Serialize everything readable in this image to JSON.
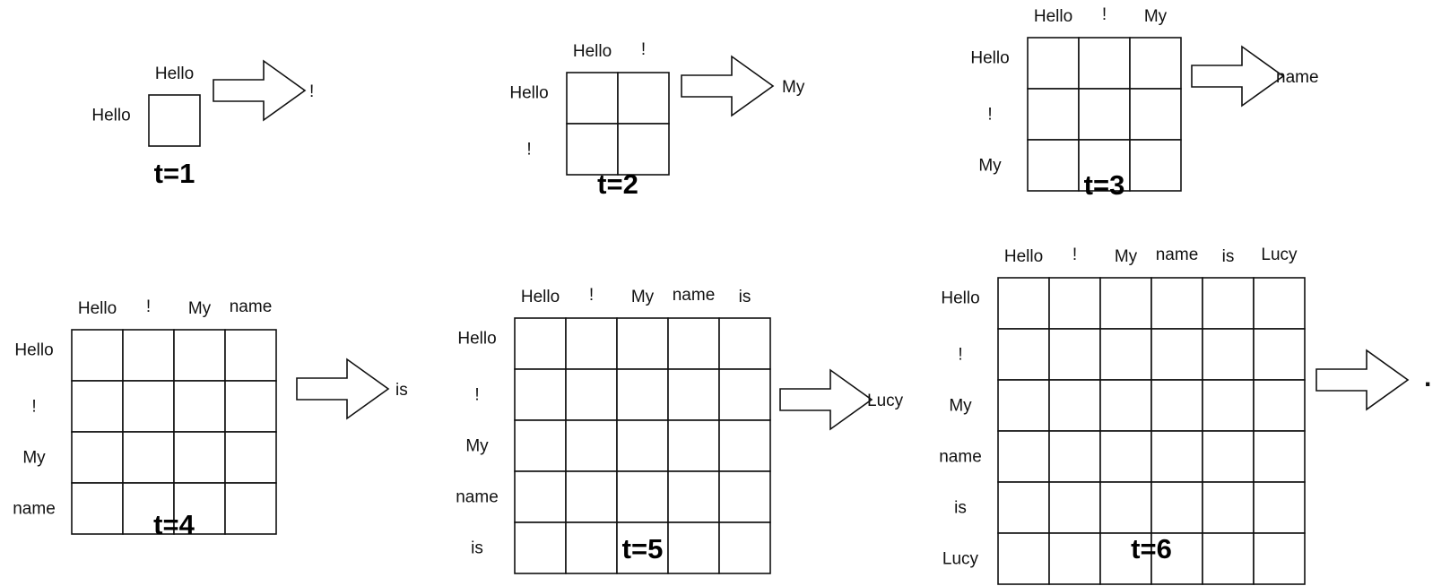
{
  "steps": [
    {
      "label": "t=1",
      "tokens": [
        "Hello"
      ],
      "output": "!"
    },
    {
      "label": "t=2",
      "tokens": [
        "Hello",
        "!"
      ],
      "output": "My"
    },
    {
      "label": "t=3",
      "tokens": [
        "Hello",
        "!",
        "My"
      ],
      "output": "name"
    },
    {
      "label": "t=4",
      "tokens": [
        "Hello",
        "!",
        "My",
        "name"
      ],
      "output": "is"
    },
    {
      "label": "t=5",
      "tokens": [
        "Hello",
        "!",
        "My",
        "name",
        "is"
      ],
      "output": "Lucy"
    },
    {
      "label": "t=6",
      "tokens": [
        "Hello",
        "!",
        "My",
        "name",
        "is",
        "Lucy"
      ],
      "output": "."
    }
  ]
}
